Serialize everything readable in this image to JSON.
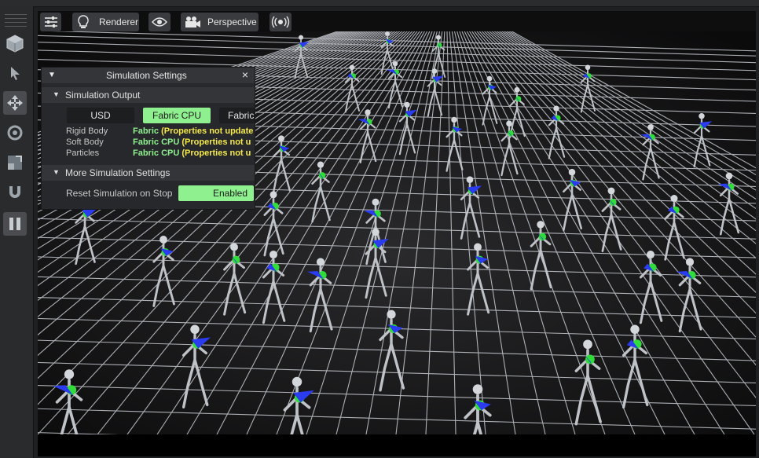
{
  "viewport_toolbar": {
    "renderer_label": "Renderer",
    "camera_label": "Perspective"
  },
  "left_toolbar": {
    "tools": [
      "viewport-cube-icon",
      "select-arrow-icon",
      "move-icon",
      "rotate-icon",
      "scale-icon",
      "snap-magnet-icon",
      "pause-icon"
    ]
  },
  "sim_panel": {
    "title": "Simulation Settings",
    "close_glyph": "×",
    "output_section": {
      "title": "Simulation Output",
      "options": [
        "USD",
        "Fabric CPU",
        "Fabric"
      ],
      "selected": "Fabric CPU",
      "rows": [
        {
          "label": "Rigid Body",
          "value_green": "Fabric",
          "value_yellow": "(Properties not update"
        },
        {
          "label": "Soft Body",
          "value_green": "Fabric CPU",
          "value_yellow": "(Properties not u"
        },
        {
          "label": "Particles",
          "value_green": "Fabric CPU",
          "value_yellow": "(Properties not u"
        }
      ]
    },
    "more_section": {
      "title": "More Simulation Settings",
      "reset_label": "Reset Simulation on Stop",
      "reset_value": "Enabled"
    }
  },
  "colors": {
    "accent_green": "#8ef08e",
    "warning_yellow": "#f5e94a",
    "grid_line": "#dfe3ea"
  }
}
